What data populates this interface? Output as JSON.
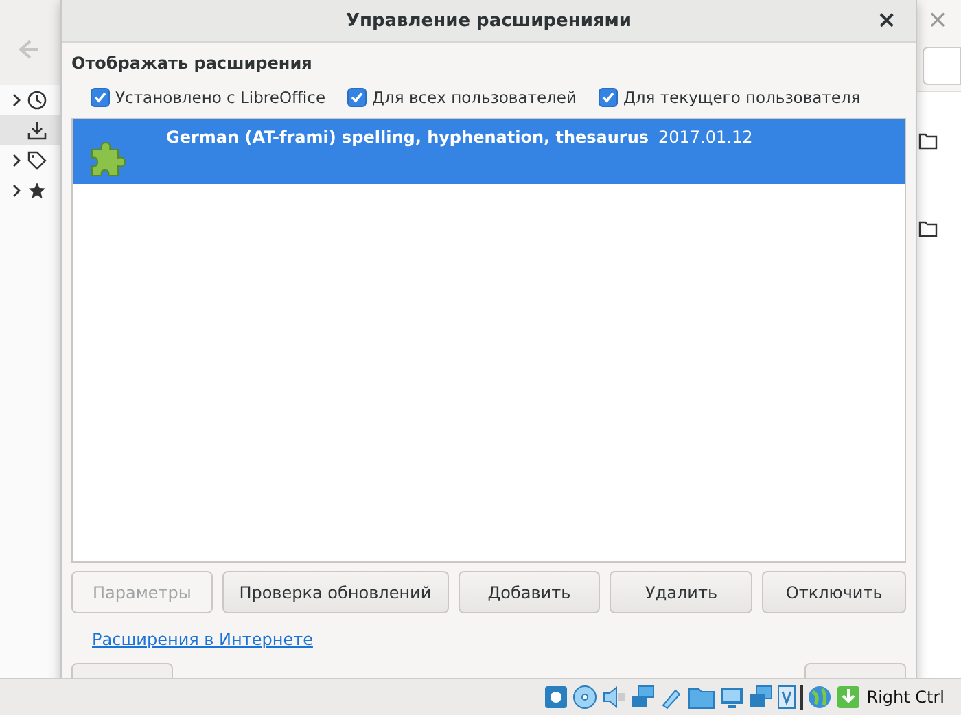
{
  "background_window": {
    "sidebar_items": [
      {
        "kind": "clock",
        "expandable": true,
        "selected": false
      },
      {
        "kind": "download",
        "expandable": false,
        "selected": true
      },
      {
        "kind": "tag",
        "expandable": true,
        "selected": false
      },
      {
        "kind": "star",
        "expandable": true,
        "selected": false
      }
    ]
  },
  "dialog": {
    "title": "Управление расширениями",
    "close": "×",
    "filter_label": "Отображать расширения",
    "filters": [
      {
        "label": "Установлено с LibreOffice",
        "checked": true
      },
      {
        "label": "Для всех пользователей",
        "checked": true
      },
      {
        "label": "Для текущего пользователя",
        "checked": true
      }
    ],
    "extensions": [
      {
        "name": "German (AT-frami) spelling, hyphenation, thesaurus",
        "version": "2017.01.12",
        "selected": true
      }
    ],
    "buttons": [
      {
        "label": "Параметры",
        "disabled": true
      },
      {
        "label": "Проверка обновлений",
        "disabled": false
      },
      {
        "label": "Добавить",
        "disabled": false
      },
      {
        "label": "Удалить",
        "disabled": false
      },
      {
        "label": "Отключить",
        "disabled": false
      }
    ],
    "link": "Расширения в Интернете"
  },
  "taskbar": {
    "host_key": "Right Ctrl"
  }
}
